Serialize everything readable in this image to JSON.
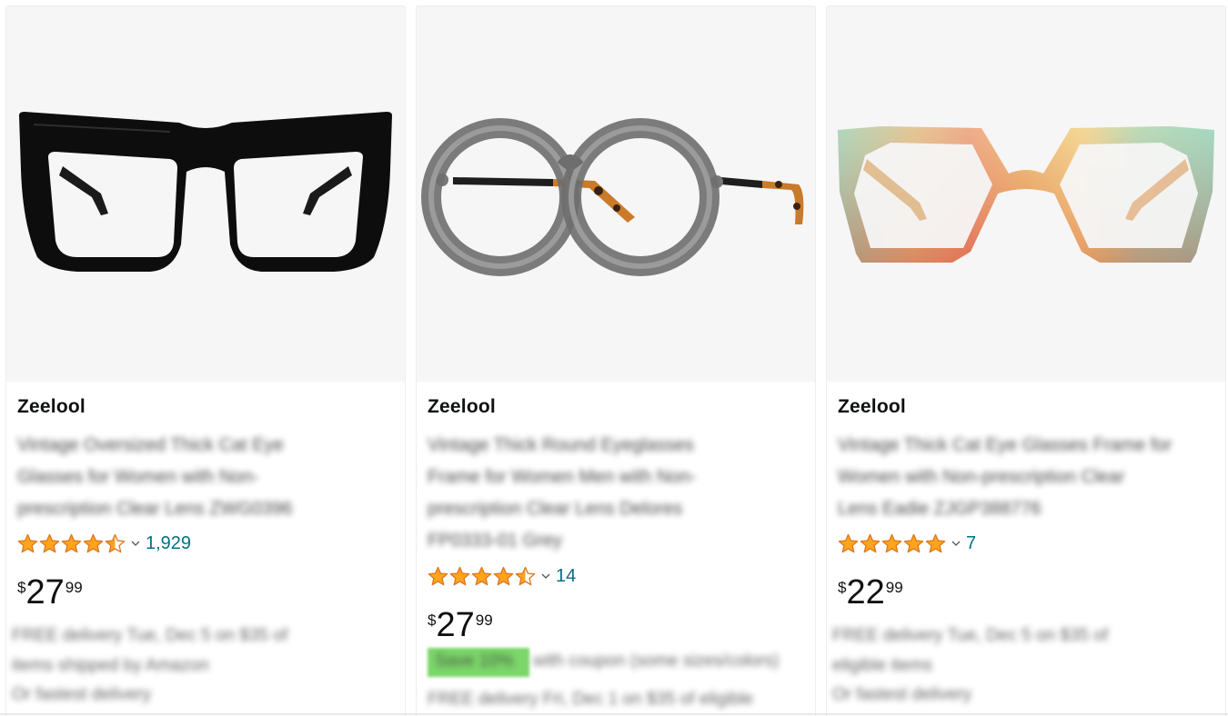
{
  "products": [
    {
      "brand": "Zeelool",
      "title_lines": [
        "Vintage Oversized Thick Cat Eye",
        "Glasses for Women with Non-",
        "prescription Clear Lens ZWG0396"
      ],
      "rating": 4.5,
      "rating_count": "1,929",
      "price": {
        "symbol": "$",
        "whole": "27",
        "fraction": "99"
      },
      "delivery_lines": [
        "FREE delivery Tue, Dec 5 on $35 of",
        "items shipped by Amazon",
        "Or fastest delivery"
      ]
    },
    {
      "brand": "Zeelool",
      "title_lines": [
        "Vintage Thick Round Eyeglasses",
        "Frame for Women Men with Non-",
        "prescription Clear Lens Delores",
        "FP0333-01 Grey"
      ],
      "rating": 4.5,
      "rating_count": "14",
      "price": {
        "symbol": "$",
        "whole": "27",
        "fraction": "99"
      },
      "coupon_text": "Save 10%",
      "coupon_detail": "with coupon (some sizes/colors)",
      "delivery_lines": [
        "FREE delivery Fri, Dec 1 on $35 of eligible"
      ]
    },
    {
      "brand": "Zeelool",
      "title_lines": [
        "Vintage Thick Cat Eye Glasses Frame for",
        "Women with Non-prescription Clear",
        "Lens Eadie ZJGP388776"
      ],
      "rating": 5,
      "rating_count": "7",
      "price": {
        "symbol": "$",
        "whole": "22",
        "fraction": "99"
      },
      "delivery_lines": [
        "FREE delivery Tue, Dec 5 on $35 of",
        "eligible items",
        "Or fastest delivery"
      ]
    }
  ],
  "colors": {
    "star": "#ffa41c",
    "star_stroke": "#de7921",
    "link": "#007185",
    "coupon": "#7cd66a",
    "image_bg": "#f6f6f6"
  }
}
